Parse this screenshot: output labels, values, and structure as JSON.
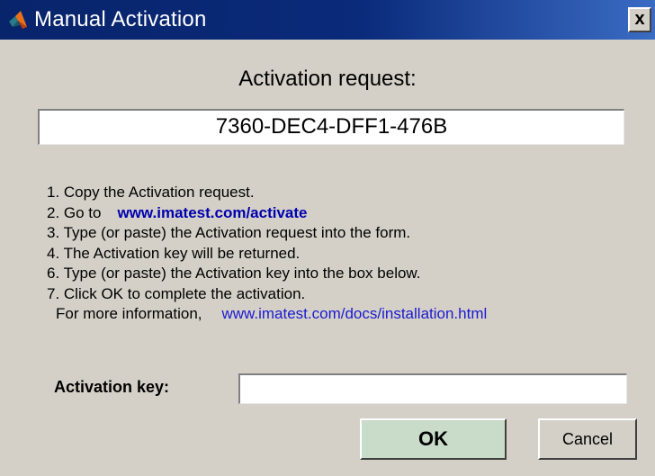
{
  "window": {
    "title": "Manual Activation",
    "close_label": "x",
    "app_icon": "matlab-logo-icon"
  },
  "heading": "Activation request:",
  "activation_request": "7360-DEC4-DFF1-476B",
  "steps": {
    "step1": "1. Copy the Activation request.",
    "step2_prefix": "2. Go to",
    "step2_link": "www.imatest.com/activate",
    "step3": "3. Type (or paste) the Activation request into the form.",
    "step4": "4. The Activation key will be returned.",
    "step6": "6. Type (or paste) the Activation key into the box below.",
    "step7": "7. Click OK to complete the activation.",
    "info_prefix": "For more information,",
    "info_link": "www.imatest.com/docs/installation.html"
  },
  "activation_key": {
    "label": "Activation key:",
    "value": ""
  },
  "buttons": {
    "ok": "OK",
    "cancel": "Cancel"
  },
  "colors": {
    "title_bar": "#0a246a",
    "dialog_bg": "#d4d0c8",
    "ok_button_bg": "#c9dcc9",
    "activate_link": "#0000b0",
    "info_link": "#1a1ad0"
  }
}
